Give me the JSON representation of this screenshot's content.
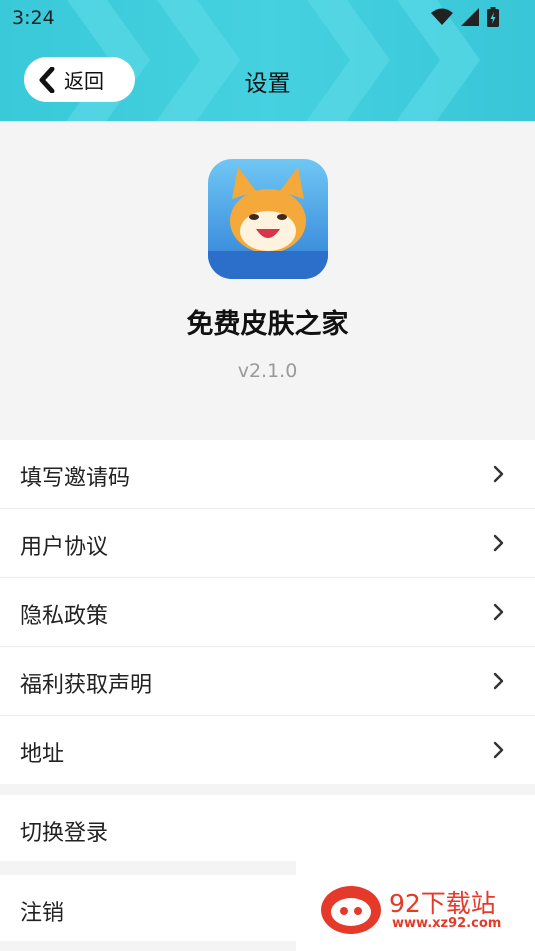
{
  "status_bar": {
    "time": "3:24",
    "icons": [
      "wifi-icon",
      "signal-icon",
      "battery-icon"
    ]
  },
  "header": {
    "back_label": "返回",
    "title": "设置"
  },
  "app": {
    "name": "免费皮肤之家",
    "version": "v2.1.0",
    "icon_caption": "免费皮肤之家"
  },
  "menu": {
    "items": [
      {
        "label": "填写邀请码"
      },
      {
        "label": "用户协议"
      },
      {
        "label": "隐私政策"
      },
      {
        "label": "福利获取声明"
      },
      {
        "label": "地址"
      }
    ],
    "switch_login": "切换登录",
    "logout": "注销"
  },
  "watermark": {
    "title": "92下载站",
    "url": "www.xz92.com"
  },
  "colors": {
    "header": "#3fcbdc",
    "accent_red": "#e53a2a"
  }
}
